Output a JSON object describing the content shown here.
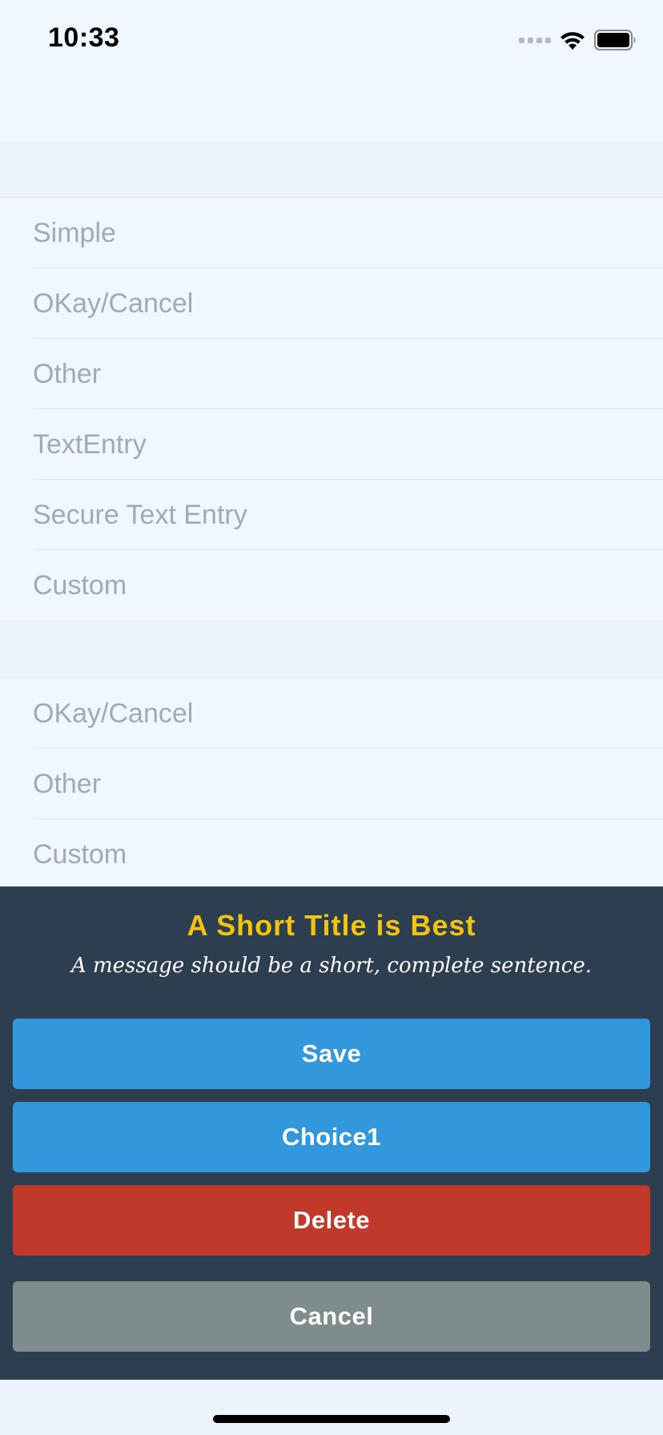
{
  "status_bar": {
    "time": "10:33",
    "icons": [
      "signal-dots-icon",
      "wifi-icon",
      "battery-icon"
    ]
  },
  "table": {
    "section1_rows": [
      {
        "label": "Simple"
      },
      {
        "label": "OKay/Cancel"
      },
      {
        "label": "Other"
      },
      {
        "label": "TextEntry"
      },
      {
        "label": "Secure Text Entry"
      },
      {
        "label": "Custom"
      }
    ],
    "section2_rows": [
      {
        "label": "OKay/Cancel"
      },
      {
        "label": "Other"
      },
      {
        "label": "Custom"
      }
    ]
  },
  "alert": {
    "title": "A Short Title is Best",
    "message": "A message should be a short, complete sentence.",
    "buttons": {
      "save": "Save",
      "choice1": "Choice1",
      "delete": "Delete",
      "cancel": "Cancel"
    }
  },
  "colors": {
    "background": "#f1f7ff",
    "section_header": "#ebf3fd",
    "row_text": "#a4a9b0",
    "sheet_background": "#2d3e50",
    "title": "#f2c40f",
    "save_button": "#3398db",
    "choice_button": "#3398db",
    "delete_button": "#c0392b",
    "cancel_button": "#7f8c8d"
  }
}
